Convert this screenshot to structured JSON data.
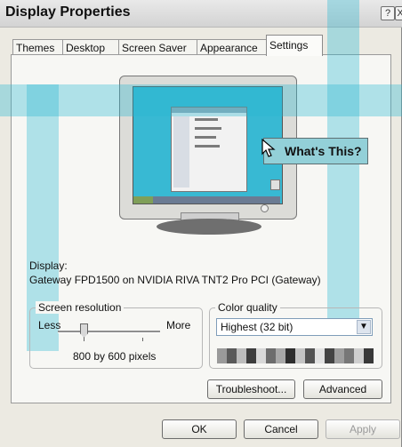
{
  "window": {
    "title": "Display Properties",
    "help_button": "?",
    "close_button": "X"
  },
  "tabs": [
    "Themes",
    "Desktop",
    "Screen Saver",
    "Appearance",
    "Settings"
  ],
  "active_tab": "Settings",
  "tooltip": {
    "text": "What's This?"
  },
  "display": {
    "label": "Display:",
    "device": "Gateway FPD1500 on NVIDIA RIVA TNT2 Pro PCI (Gateway)"
  },
  "screen_resolution": {
    "title": "Screen resolution",
    "less_label": "Less",
    "more_label": "More",
    "value_text": "800 by 600 pixels",
    "slider_position": 0.25
  },
  "color_quality": {
    "title": "Color quality",
    "selected": "Highest (32 bit)"
  },
  "buttons": {
    "troubleshoot": "Troubleshoot...",
    "advanced": "Advanced",
    "ok": "OK",
    "cancel": "Cancel",
    "apply": "Apply"
  },
  "colors": {
    "watermark": "#27b6d2",
    "tooltip_bg": "#93d0d8",
    "desktop_blue": "#38b9d3"
  }
}
